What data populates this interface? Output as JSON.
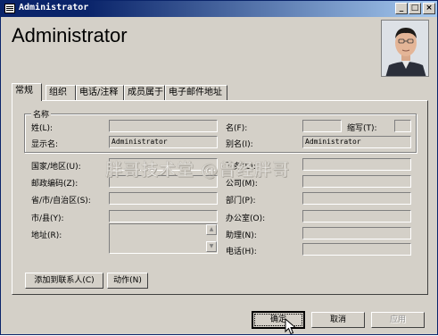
{
  "window": {
    "title": "Administrator",
    "controls": {
      "minimize": "_",
      "maximize": "□",
      "close": "×"
    }
  },
  "header": {
    "name": "Administrator"
  },
  "tabs": [
    {
      "label": "常规",
      "active": true
    },
    {
      "label": "组织",
      "active": false
    },
    {
      "label": "电话/注释",
      "active": false
    },
    {
      "label": "成员属于",
      "active": false
    },
    {
      "label": "电子邮件地址",
      "active": false
    }
  ],
  "name_group": {
    "label": "名称",
    "last_name": {
      "label": "姓(L):",
      "value": ""
    },
    "first_name": {
      "label": "名(F):",
      "value": ""
    },
    "initials": {
      "label": "缩写(T):",
      "value": ""
    },
    "display_name": {
      "label": "显示名:",
      "value": "Administrator"
    },
    "alias": {
      "label": "别名(I):",
      "value": "Administrator"
    }
  },
  "left_fields": {
    "country": {
      "label": "国家/地区(U):",
      "value": ""
    },
    "postal_code": {
      "label": "邮政编码(Z):",
      "value": ""
    },
    "state": {
      "label": "省/市/自治区(S):",
      "value": ""
    },
    "city": {
      "label": "市/县(Y):",
      "value": ""
    },
    "address": {
      "label": "地址(R):",
      "value": ""
    }
  },
  "right_fields": {
    "title": {
      "label": "职务(E):",
      "value": ""
    },
    "company": {
      "label": "公司(M):",
      "value": ""
    },
    "department": {
      "label": "部门(P):",
      "value": ""
    },
    "office": {
      "label": "办公室(O):",
      "value": ""
    },
    "assistant": {
      "label": "助理(N):",
      "value": ""
    },
    "phone": {
      "label": "电话(H):",
      "value": ""
    }
  },
  "panel_buttons": {
    "add_to_contacts": "添加到联系人(C)",
    "actions": "动作(N)"
  },
  "dialog_buttons": {
    "ok": "确定",
    "cancel": "取消",
    "apply": "应用"
  },
  "watermark": "胖哥技术堂 @曾经胖哥"
}
